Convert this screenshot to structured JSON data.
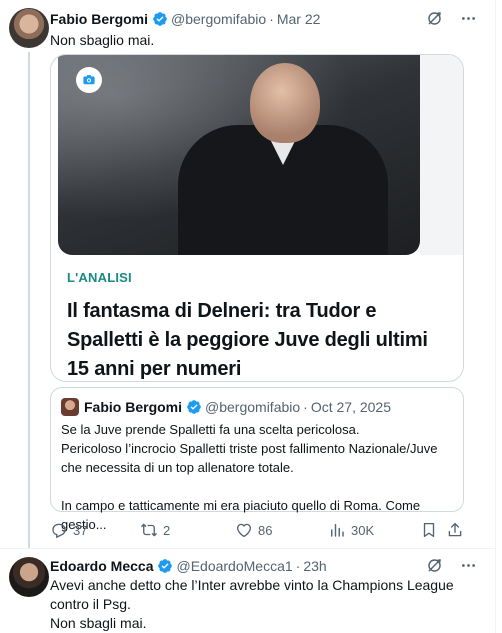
{
  "colors": {
    "accent": "#1d9bf0",
    "secondary_text": "#536471",
    "kicker": "#1a8a83",
    "border": "#cfd9de"
  },
  "tweet1": {
    "author_name": "Fabio Bergomi",
    "handle": "@bergomifabio",
    "separator": "·",
    "date": "Mar 22",
    "text": "Non sbaglio mai.",
    "card": {
      "image_icon": "camera-icon",
      "kicker": "L'ANALISI",
      "title": "Il fantasma di Delneri: tra Tudor e Spalletti è la peggiore Juve degli ultimi 15 anni per numeri"
    },
    "quote": {
      "author_name": "Fabio Bergomi",
      "handle": "@bergomifabio",
      "separator": "·",
      "date": "Oct 27, 2025",
      "lines": [
        "Se la Juve prende Spalletti fa una scelta pericolosa.",
        "Pericoloso l’incrocio Spalletti triste post fallimento Nazionale/Juve che necessita di un top allenatore totale.",
        "",
        "In campo e tatticamente mi era piaciuto quello di Roma. Come gestio..."
      ]
    },
    "actions": {
      "replies": "37",
      "reposts": "2",
      "likes": "86",
      "views": "30K"
    }
  },
  "tweet2": {
    "author_name": "Edoardo Mecca",
    "handle": "@EdoardoMecca1",
    "separator": "·",
    "date": "23h",
    "text_lines": [
      "Avevi anche detto che l’Inter avrebbe vinto la Champions League contro il Psg.",
      "Non sbagli mai."
    ]
  }
}
